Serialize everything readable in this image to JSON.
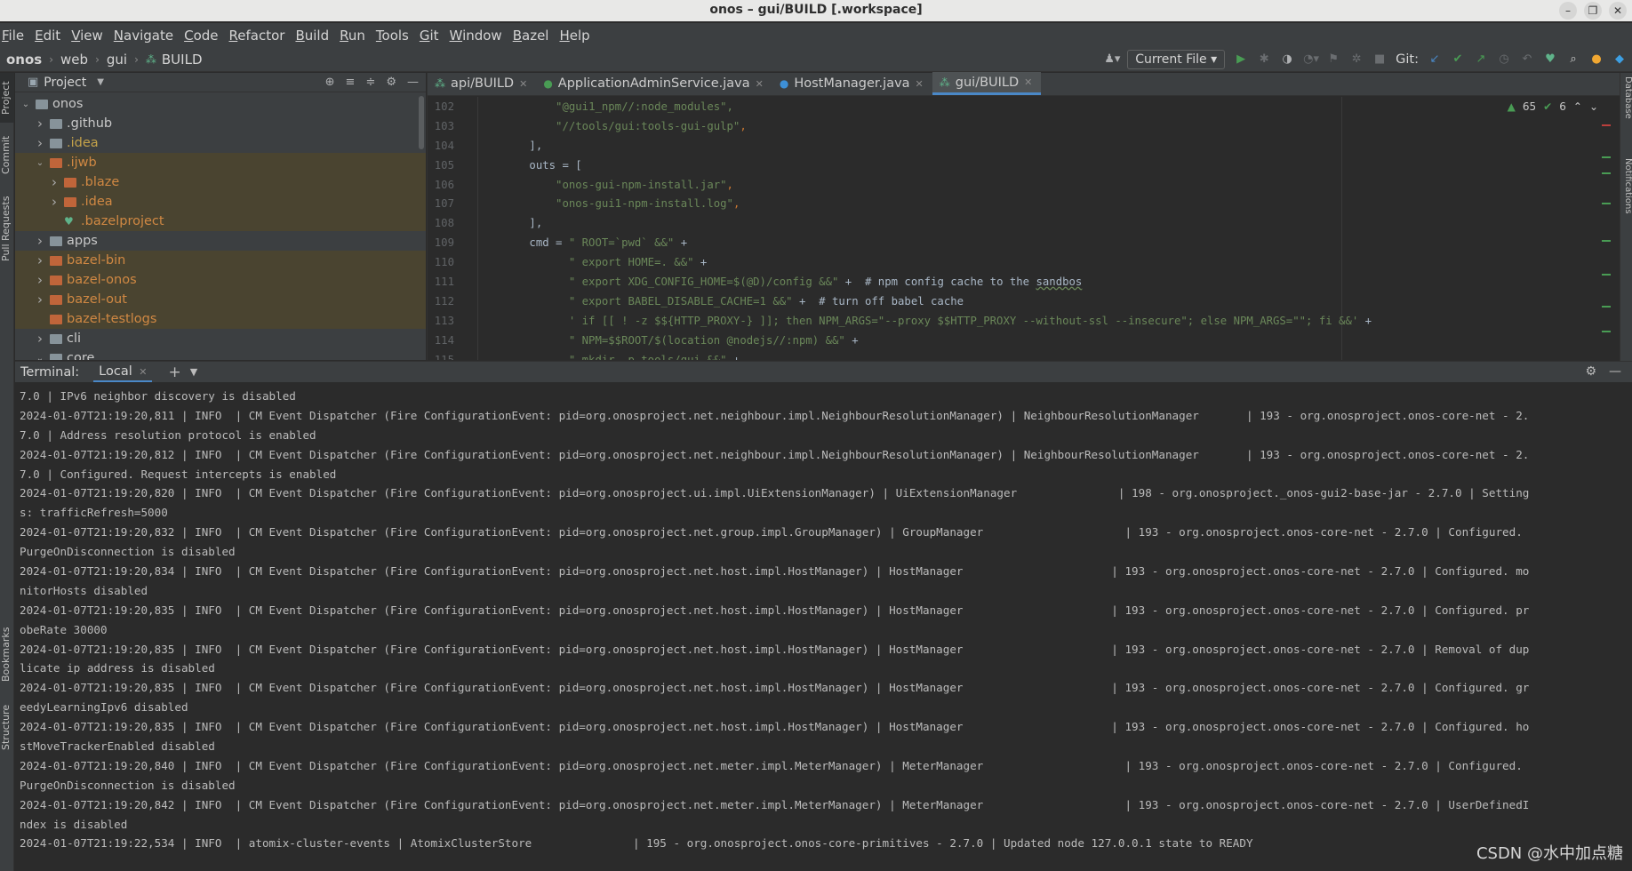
{
  "window": {
    "title": "onos – gui/BUILD [.workspace]",
    "controls": [
      "–",
      "❐",
      "✕"
    ]
  },
  "menu": [
    "File",
    "Edit",
    "View",
    "Navigate",
    "Code",
    "Refactor",
    "Build",
    "Run",
    "Tools",
    "Git",
    "Window",
    "Bazel",
    "Help"
  ],
  "breadcrumb": [
    "onos",
    "web",
    "gui",
    "BUILD"
  ],
  "toolbar": {
    "run_config": "Current File",
    "git_label": "Git:"
  },
  "left_strip": [
    "Project",
    "Commit",
    "Pull Requests",
    "Bookmarks",
    "Structure"
  ],
  "right_strip": [
    "Database",
    "Notifications"
  ],
  "project_panel": {
    "title": "Project",
    "tree": [
      {
        "label": "onos",
        "depth": 0,
        "expanded": true,
        "type": "folder-grey",
        "hl": false
      },
      {
        "label": ".github",
        "depth": 1,
        "expanded": false,
        "type": "folder-grey",
        "hl": false
      },
      {
        "label": ".idea",
        "depth": 1,
        "expanded": false,
        "type": "folder-grey",
        "hl": false,
        "style": "idea"
      },
      {
        "label": ".ijwb",
        "depth": 1,
        "expanded": true,
        "type": "folder-orange",
        "hl": true,
        "style": "excl"
      },
      {
        "label": ".blaze",
        "depth": 2,
        "expanded": false,
        "type": "folder-orange",
        "hl": true,
        "style": "excl"
      },
      {
        "label": ".idea",
        "depth": 2,
        "expanded": false,
        "type": "folder-orange",
        "hl": true,
        "style": "excl"
      },
      {
        "label": ".bazelproject",
        "depth": 2,
        "expanded": null,
        "type": "bazel",
        "hl": true,
        "style": "excl"
      },
      {
        "label": "apps",
        "depth": 1,
        "expanded": false,
        "type": "folder-grey",
        "hl": false
      },
      {
        "label": "bazel-bin",
        "depth": 1,
        "expanded": false,
        "type": "folder-orange",
        "hl": true,
        "style": "excl"
      },
      {
        "label": "bazel-onos",
        "depth": 1,
        "expanded": false,
        "type": "folder-orange",
        "hl": true,
        "style": "excl"
      },
      {
        "label": "bazel-out",
        "depth": 1,
        "expanded": false,
        "type": "folder-orange",
        "hl": true,
        "style": "excl"
      },
      {
        "label": "bazel-testlogs",
        "depth": 1,
        "expanded": null,
        "type": "folder-orange",
        "hl": true,
        "style": "excl"
      },
      {
        "label": "cli",
        "depth": 1,
        "expanded": false,
        "type": "folder-grey",
        "hl": false
      },
      {
        "label": "core",
        "depth": 1,
        "expanded": true,
        "type": "folder-grey",
        "hl": false
      }
    ]
  },
  "editor": {
    "tabs": [
      {
        "label": "api/BUILD",
        "icon": "bazel",
        "active": false
      },
      {
        "label": "ApplicationAdminService.java",
        "icon": "interface",
        "active": false
      },
      {
        "label": "HostManager.java",
        "icon": "class",
        "active": false
      },
      {
        "label": "gui/BUILD",
        "icon": "bazel",
        "active": true
      }
    ],
    "inspections": {
      "ok": "65",
      "check": "6"
    },
    "lines": [
      {
        "n": "102",
        "indent": "          ",
        "parts": [
          [
            "str",
            "\"@gui1_npm//:node_modules\","
          ]
        ]
      },
      {
        "n": "103",
        "indent": "          ",
        "parts": [
          [
            "str",
            "\"//tools/gui:tools-gui-gulp\""
          ],
          [
            "op",
            ","
          ]
        ]
      },
      {
        "n": "104",
        "indent": "      ",
        "parts": [
          [
            "txt",
            "],"
          ]
        ]
      },
      {
        "n": "105",
        "indent": "      ",
        "parts": [
          [
            "txt",
            "outs = ["
          ]
        ]
      },
      {
        "n": "106",
        "indent": "          ",
        "parts": [
          [
            "str",
            "\"onos-gui-npm-install.jar\""
          ],
          [
            "op",
            ","
          ]
        ]
      },
      {
        "n": "107",
        "indent": "          ",
        "parts": [
          [
            "str",
            "\"onos-gui1-npm-install.log\""
          ],
          [
            "op",
            ","
          ]
        ]
      },
      {
        "n": "108",
        "indent": "      ",
        "parts": [
          [
            "txt",
            "],"
          ]
        ]
      },
      {
        "n": "109",
        "indent": "      ",
        "parts": [
          [
            "txt",
            "cmd = "
          ],
          [
            "str",
            "\" ROOT=`pwd` &&\""
          ],
          [
            "txt",
            " +"
          ]
        ]
      },
      {
        "n": "110",
        "indent": "            ",
        "parts": [
          [
            "str",
            "\" export HOME=. &&\""
          ],
          [
            "txt",
            " +"
          ]
        ]
      },
      {
        "n": "111",
        "indent": "            ",
        "parts": [
          [
            "str",
            "\" export XDG_CONFIG_HOME=$(@D)/config &&\""
          ],
          [
            "txt",
            " +  # npm config cache to the "
          ],
          [
            "wavy",
            "sandbos"
          ]
        ]
      },
      {
        "n": "112",
        "indent": "            ",
        "parts": [
          [
            "str",
            "\" export BABEL_DISABLE_CACHE=1 &&\""
          ],
          [
            "txt",
            " +  # turn off babel cache"
          ]
        ]
      },
      {
        "n": "113",
        "indent": "            ",
        "parts": [
          [
            "str",
            "' if [[ ! -z $${HTTP_PROXY-} ]]; then NPM_ARGS=\"--proxy $$HTTP_PROXY --without-ssl --insecure\"; else NPM_ARGS=\"\"; fi &&'"
          ],
          [
            "txt",
            " +"
          ]
        ]
      },
      {
        "n": "114",
        "indent": "            ",
        "parts": [
          [
            "str",
            "\" NPM=$$ROOT/$(location @nodejs//:npm) &&\""
          ],
          [
            "txt",
            " +"
          ]
        ]
      },
      {
        "n": "115",
        "indent": "            ",
        "parts": [
          [
            "str",
            "\" mkdir -p tools/gui &&\""
          ],
          [
            "txt",
            " +"
          ]
        ]
      }
    ]
  },
  "terminal": {
    "label": "Terminal:",
    "tab": "Local",
    "lines": [
      "7.0 | IPv6 neighbor discovery is disabled",
      "2024-01-07T21:19:20,811 | INFO  | CM Event Dispatcher (Fire ConfigurationEvent: pid=org.onosproject.net.neighbour.impl.NeighbourResolutionManager) | NeighbourResolutionManager       | 193 - org.onosproject.onos-core-net - 2.",
      "7.0 | Address resolution protocol is enabled",
      "2024-01-07T21:19:20,812 | INFO  | CM Event Dispatcher (Fire ConfigurationEvent: pid=org.onosproject.net.neighbour.impl.NeighbourResolutionManager) | NeighbourResolutionManager       | 193 - org.onosproject.onos-core-net - 2.",
      "7.0 | Configured. Request intercepts is enabled",
      "2024-01-07T21:19:20,820 | INFO  | CM Event Dispatcher (Fire ConfigurationEvent: pid=org.onosproject.ui.impl.UiExtensionManager) | UiExtensionManager               | 198 - org.onosproject._onos-gui2-base-jar - 2.7.0 | Setting",
      "s: trafficRefresh=5000",
      "2024-01-07T21:19:20,832 | INFO  | CM Event Dispatcher (Fire ConfigurationEvent: pid=org.onosproject.net.group.impl.GroupManager) | GroupManager                     | 193 - org.onosproject.onos-core-net - 2.7.0 | Configured.",
      "PurgeOnDisconnection is disabled",
      "2024-01-07T21:19:20,834 | INFO  | CM Event Dispatcher (Fire ConfigurationEvent: pid=org.onosproject.net.host.impl.HostManager) | HostManager                      | 193 - org.onosproject.onos-core-net - 2.7.0 | Configured. mo",
      "nitorHosts disabled",
      "2024-01-07T21:19:20,835 | INFO  | CM Event Dispatcher (Fire ConfigurationEvent: pid=org.onosproject.net.host.impl.HostManager) | HostManager                      | 193 - org.onosproject.onos-core-net - 2.7.0 | Configured. pr",
      "obeRate 30000",
      "2024-01-07T21:19:20,835 | INFO  | CM Event Dispatcher (Fire ConfigurationEvent: pid=org.onosproject.net.host.impl.HostManager) | HostManager                      | 193 - org.onosproject.onos-core-net - 2.7.0 | Removal of dup",
      "licate ip address is disabled",
      "2024-01-07T21:19:20,835 | INFO  | CM Event Dispatcher (Fire ConfigurationEvent: pid=org.onosproject.net.host.impl.HostManager) | HostManager                      | 193 - org.onosproject.onos-core-net - 2.7.0 | Configured. gr",
      "eedyLearningIpv6 disabled",
      "2024-01-07T21:19:20,835 | INFO  | CM Event Dispatcher (Fire ConfigurationEvent: pid=org.onosproject.net.host.impl.HostManager) | HostManager                      | 193 - org.onosproject.onos-core-net - 2.7.0 | Configured. ho",
      "stMoveTrackerEnabled disabled",
      "2024-01-07T21:19:20,840 | INFO  | CM Event Dispatcher (Fire ConfigurationEvent: pid=org.onosproject.net.meter.impl.MeterManager) | MeterManager                     | 193 - org.onosproject.onos-core-net - 2.7.0 | Configured.",
      "PurgeOnDisconnection is disabled",
      "2024-01-07T21:19:20,842 | INFO  | CM Event Dispatcher (Fire ConfigurationEvent: pid=org.onosproject.net.meter.impl.MeterManager) | MeterManager                     | 193 - org.onosproject.onos-core-net - 2.7.0 | UserDefinedI",
      "ndex is disabled",
      "2024-01-07T21:19:22,534 | INFO  | atomix-cluster-events | AtomixClusterStore               | 195 - org.onosproject.onos-core-primitives - 2.7.0 | Updated node 127.0.0.1 state to READY"
    ]
  },
  "watermark": "CSDN @水中加点糖",
  "colors": {
    "accent": "#4a88c7",
    "excluded": "#d08843",
    "string": "#6a8759",
    "ok": "#499c54"
  }
}
